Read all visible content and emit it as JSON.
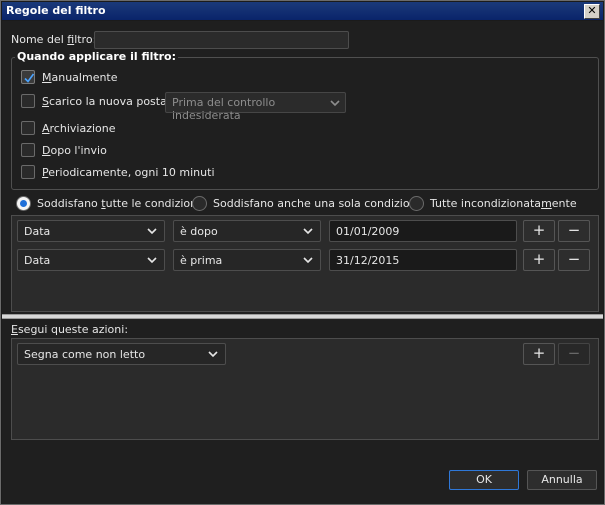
{
  "window": {
    "title": "Regole del filtro",
    "close_glyph": "✕"
  },
  "filter_name": {
    "label_pre": "Nome del ",
    "label_u": "f",
    "label_post": "iltro:",
    "value": ""
  },
  "when": {
    "legend": "Quando applicare il filtro:",
    "options": [
      {
        "pre": "",
        "u": "M",
        "post": "anualmente",
        "checked": true
      },
      {
        "pre": "",
        "u": "S",
        "post": "carico la nuova posta:",
        "checked": false
      },
      {
        "pre": "",
        "u": "A",
        "post": "rchiviazione",
        "checked": false
      },
      {
        "pre": "",
        "u": "D",
        "post": "opo l'invio",
        "checked": false
      },
      {
        "pre": "",
        "u": "P",
        "post": "eriodicamente, ogni 10 minuti",
        "checked": false
      }
    ],
    "download_select": "Prima del controllo indesiderata"
  },
  "match": {
    "options": [
      {
        "pre": "Soddisfano ",
        "u": "t",
        "post": "utte le condizioni",
        "selected": true
      },
      {
        "pre": "Soddisfano anche una sola condizione",
        "u": "",
        "post": "",
        "selected": false
      },
      {
        "pre": "Tutte incondizionata",
        "u": "m",
        "post": "ente",
        "selected": false
      }
    ]
  },
  "conditions": [
    {
      "field": "Data",
      "operator": "è dopo",
      "value": "01/01/2009"
    },
    {
      "field": "Data",
      "operator": "è prima",
      "value": "31/12/2015"
    }
  ],
  "actions": {
    "label_pre": "",
    "label_u": "E",
    "label_post": "segui queste azioni:",
    "items": [
      {
        "action": "Segna come non letto"
      }
    ]
  },
  "buttons": {
    "add": "+",
    "remove": "−",
    "ok": "OK",
    "cancel": "Annulla"
  },
  "colors": {
    "accent": "#1e6fd9",
    "titlebar": "#0a246a"
  }
}
